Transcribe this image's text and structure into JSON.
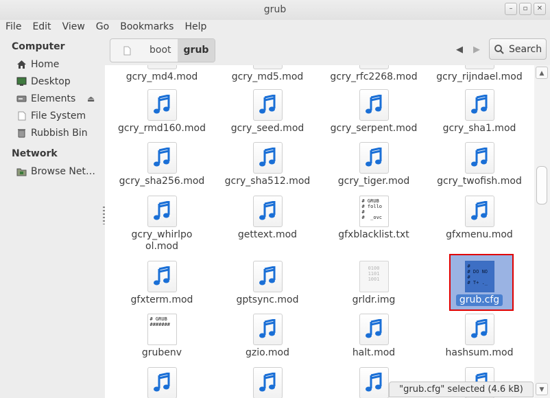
{
  "window": {
    "title": "grub"
  },
  "menu": [
    "File",
    "Edit",
    "View",
    "Go",
    "Bookmarks",
    "Help"
  ],
  "sidebar": {
    "sections": [
      {
        "heading": "Computer",
        "items": [
          {
            "label": "Home",
            "icon": "home-icon"
          },
          {
            "label": "Desktop",
            "icon": "desktop-icon"
          },
          {
            "label": "Elements",
            "icon": "drive-icon",
            "eject": true
          },
          {
            "label": "File System",
            "icon": "filesystem-icon"
          },
          {
            "label": "Rubbish Bin",
            "icon": "trash-icon"
          }
        ]
      },
      {
        "heading": "Network",
        "items": [
          {
            "label": "Browse Net…",
            "icon": "network-icon"
          }
        ]
      }
    ]
  },
  "toolbar": {
    "breadcrumb": [
      "boot",
      "grub"
    ],
    "search_label": "Search"
  },
  "files": [
    {
      "name": "gcry_md4.mod",
      "type": "audio"
    },
    {
      "name": "gcry_md5.mod",
      "type": "audio"
    },
    {
      "name": "gcry_rfc2268.mod",
      "type": "audio"
    },
    {
      "name": "gcry_rijndael.mod",
      "type": "audio"
    },
    {
      "name": "gcry_rmd160.mod",
      "type": "audio"
    },
    {
      "name": "gcry_seed.mod",
      "type": "audio"
    },
    {
      "name": "gcry_serpent.mod",
      "type": "audio"
    },
    {
      "name": "gcry_sha1.mod",
      "type": "audio"
    },
    {
      "name": "gcry_sha256.mod",
      "type": "audio"
    },
    {
      "name": "gcry_sha512.mod",
      "type": "audio"
    },
    {
      "name": "gcry_tiger.mod",
      "type": "audio"
    },
    {
      "name": "gcry_twofish.mod",
      "type": "audio"
    },
    {
      "name": "gcry_whirlpool.mod",
      "type": "audio"
    },
    {
      "name": "gettext.mod",
      "type": "audio"
    },
    {
      "name": "gfxblacklist.txt",
      "type": "text",
      "preview": "# GRUB\n# follo\n#\n#  _ovc"
    },
    {
      "name": "gfxmenu.mod",
      "type": "audio"
    },
    {
      "name": "gfxterm.mod",
      "type": "audio"
    },
    {
      "name": "gptsync.mod",
      "type": "audio"
    },
    {
      "name": "grldr.img",
      "type": "binary",
      "preview": "0100\n1101\n1001"
    },
    {
      "name": "grub.cfg",
      "type": "text",
      "selected": true,
      "preview": "#\n# DO NO\n#\n# T+ ._"
    },
    {
      "name": "grubenv",
      "type": "text",
      "preview": "# GRUB\n#######"
    },
    {
      "name": "gzio.mod",
      "type": "audio"
    },
    {
      "name": "halt.mod",
      "type": "audio"
    },
    {
      "name": "hashsum.mod",
      "type": "audio"
    },
    {
      "name": "",
      "type": "audio"
    },
    {
      "name": "",
      "type": "audio"
    },
    {
      "name": "",
      "type": "audio"
    },
    {
      "name": "",
      "type": "audio"
    }
  ],
  "status": "\"grub.cfg\" selected (4.6 kB)",
  "colors": {
    "selection": "#4a80d0",
    "highlight_border": "#e00000",
    "audio_icon": "#1a6fd6"
  }
}
